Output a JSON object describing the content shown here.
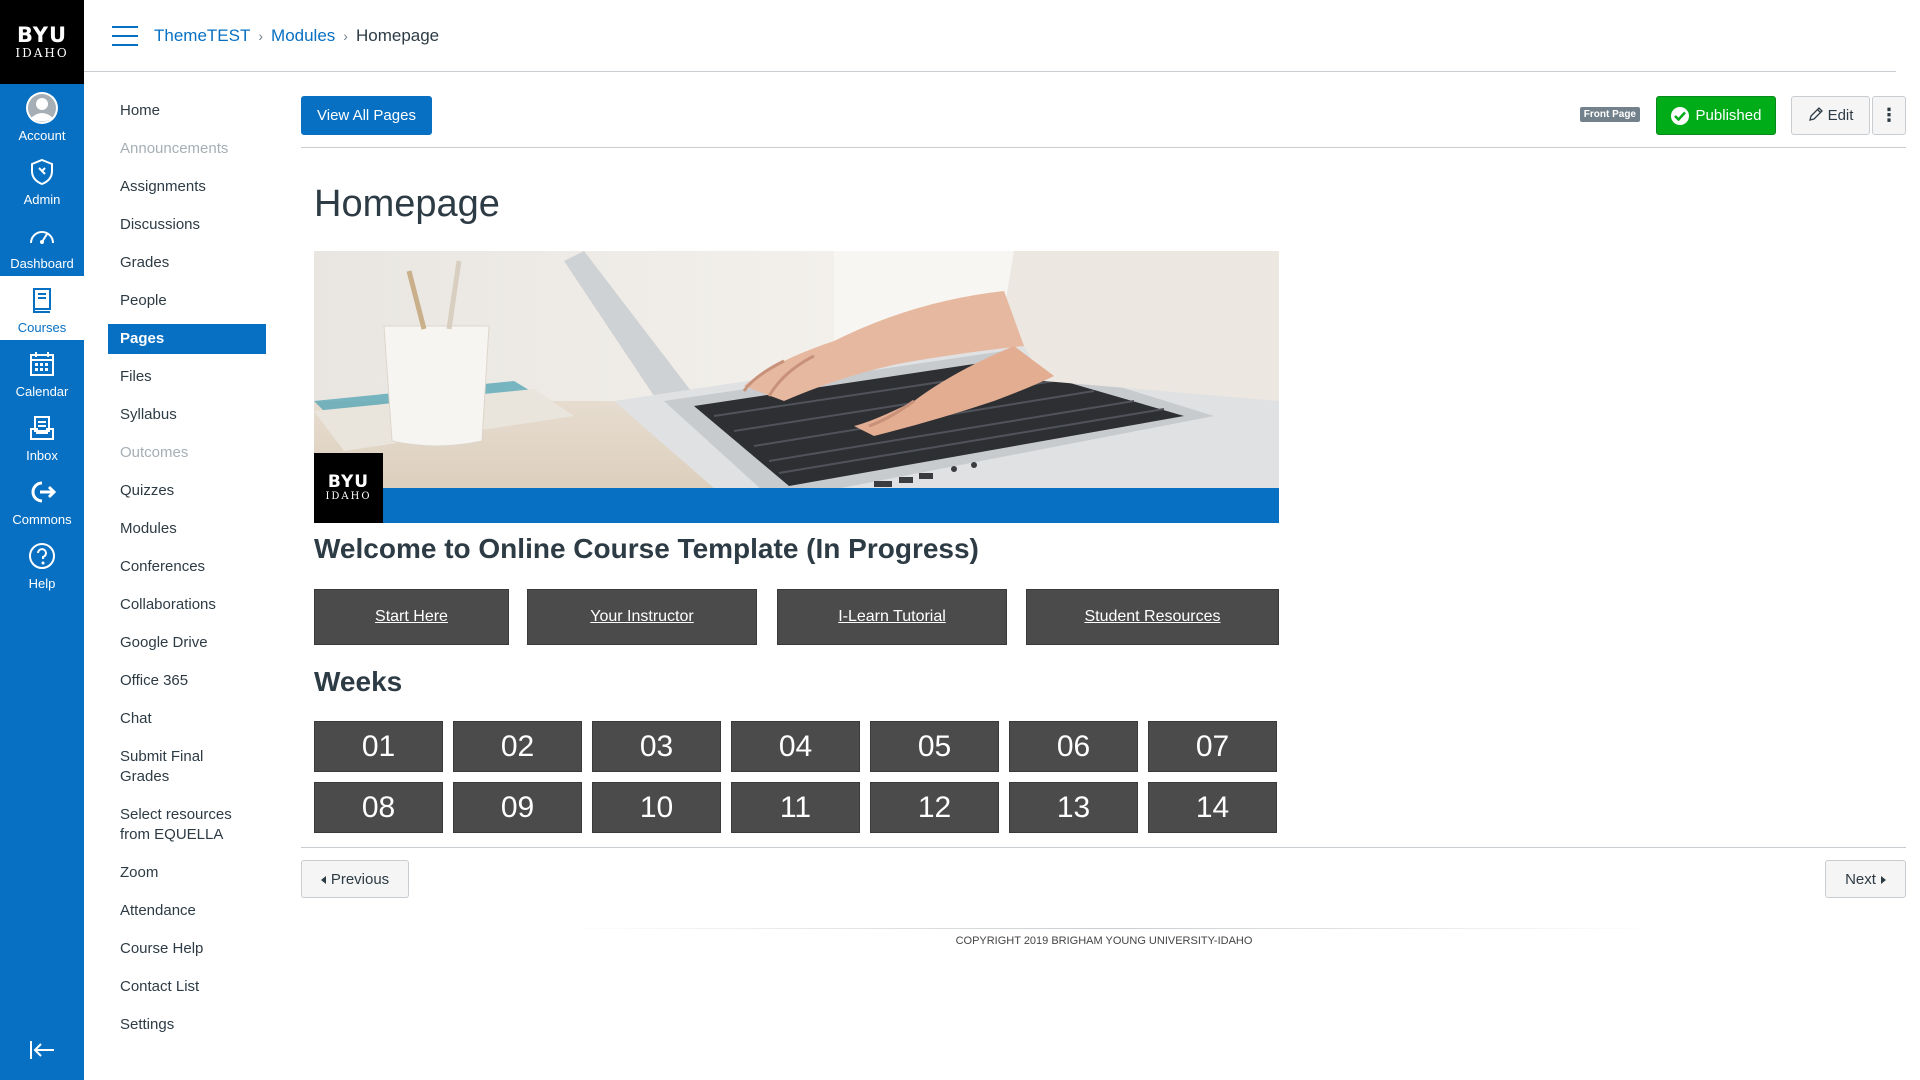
{
  "global_nav": {
    "logo": {
      "line1": "BYU",
      "line2": "IDAHO"
    },
    "items": [
      {
        "label": "Account",
        "icon": "account-icon"
      },
      {
        "label": "Admin",
        "icon": "admin-shield-icon"
      },
      {
        "label": "Dashboard",
        "icon": "dashboard-icon"
      },
      {
        "label": "Courses",
        "icon": "courses-icon",
        "active": true
      },
      {
        "label": "Calendar",
        "icon": "calendar-icon"
      },
      {
        "label": "Inbox",
        "icon": "inbox-icon"
      },
      {
        "label": "Commons",
        "icon": "commons-icon"
      },
      {
        "label": "Help",
        "icon": "help-icon"
      }
    ],
    "collapse_icon": "collapse-nav-icon"
  },
  "header": {
    "breadcrumb": [
      {
        "label": "ThemeTEST"
      },
      {
        "label": "Modules"
      },
      {
        "label": "Homepage"
      }
    ]
  },
  "course_nav": {
    "items": [
      {
        "label": "Home"
      },
      {
        "label": "Announcements",
        "disabled": true
      },
      {
        "label": "Assignments"
      },
      {
        "label": "Discussions"
      },
      {
        "label": "Grades"
      },
      {
        "label": "People"
      },
      {
        "label": "Pages",
        "active": true
      },
      {
        "label": "Files"
      },
      {
        "label": "Syllabus"
      },
      {
        "label": "Outcomes",
        "disabled": true
      },
      {
        "label": "Quizzes"
      },
      {
        "label": "Modules"
      },
      {
        "label": "Conferences"
      },
      {
        "label": "Collaborations"
      },
      {
        "label": "Google Drive"
      },
      {
        "label": "Office 365"
      },
      {
        "label": "Chat"
      },
      {
        "label": "Submit Final Grades"
      },
      {
        "label": "Select resources from EQUELLA"
      },
      {
        "label": "Zoom"
      },
      {
        "label": "Attendance"
      },
      {
        "label": "Course Help"
      },
      {
        "label": "Contact List"
      },
      {
        "label": "Settings"
      }
    ]
  },
  "toolbar": {
    "view_all_label": "View All Pages",
    "front_page_badge": "Front Page",
    "published_label": "Published",
    "edit_label": "Edit",
    "more_label": "⋮"
  },
  "content": {
    "title": "Homepage",
    "banner_logo": {
      "line1": "BYU",
      "line2": "IDAHO"
    },
    "welcome": "Welcome to Online Course Template (In Progress)",
    "nav_buttons": [
      "Start Here",
      "Your Instructor",
      "I-Learn Tutorial",
      "Student Resources"
    ],
    "weeks_title": "Weeks",
    "weeks": [
      "01",
      "02",
      "03",
      "04",
      "05",
      "06",
      "07",
      "08",
      "09",
      "10",
      "11",
      "12",
      "13",
      "14"
    ]
  },
  "footer": {
    "previous_label": "Previous",
    "next_label": "Next",
    "copyright": "COPYRIGHT 2019 BRIGHAM YOUNG UNIVERSITY-IDAHO"
  },
  "colors": {
    "brand_blue": "#0770c3",
    "published_green": "#00ac18",
    "button_dark": "#4b4b4b"
  }
}
